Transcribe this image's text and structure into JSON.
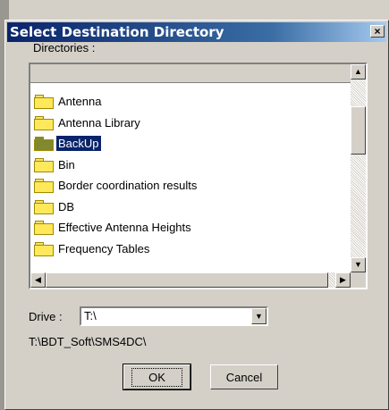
{
  "dialog": {
    "title": "Select Destination Directory",
    "close_glyph": "×"
  },
  "directories": {
    "label": "Directories :",
    "items": [
      {
        "label": "Antenna",
        "icon": "folder-icon"
      },
      {
        "label": "Antenna Library",
        "icon": "folder-icon"
      },
      {
        "label": "BackUp",
        "icon": "folder-icon",
        "selected": true
      },
      {
        "label": "Bin",
        "icon": "folder-icon"
      },
      {
        "label": "Border coordination results",
        "icon": "folder-icon"
      },
      {
        "label": "DB",
        "icon": "folder-icon"
      },
      {
        "label": "Effective Antenna Heights",
        "icon": "folder-icon"
      },
      {
        "label": "Frequency Tables",
        "icon": "folder-icon"
      }
    ]
  },
  "scroll": {
    "up": "▲",
    "down": "▼",
    "left": "◀",
    "right": "▶"
  },
  "drive": {
    "label": "Drive :",
    "value": "T:\\",
    "arrow": "▼"
  },
  "current_path": "T:\\BDT_Soft\\SMS4DC\\",
  "buttons": {
    "ok": "OK",
    "cancel": "Cancel"
  },
  "colors": {
    "title_start": "#0a246a",
    "title_end": "#a6caf0",
    "selection": "#0a246a",
    "dialog_bg": "#d4d0c8"
  }
}
